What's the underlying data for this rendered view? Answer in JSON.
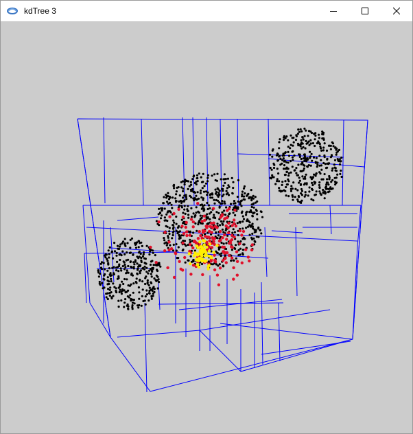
{
  "window": {
    "title": "kdTree 3",
    "controls": [
      "minimize",
      "maximize",
      "close"
    ]
  },
  "scene": {
    "background": "#cccccc",
    "box_color": "#0000ff",
    "point_colors": {
      "default": "#000000",
      "near": "#e0102a",
      "nearest": "#ffee00"
    },
    "clusters": 4
  }
}
